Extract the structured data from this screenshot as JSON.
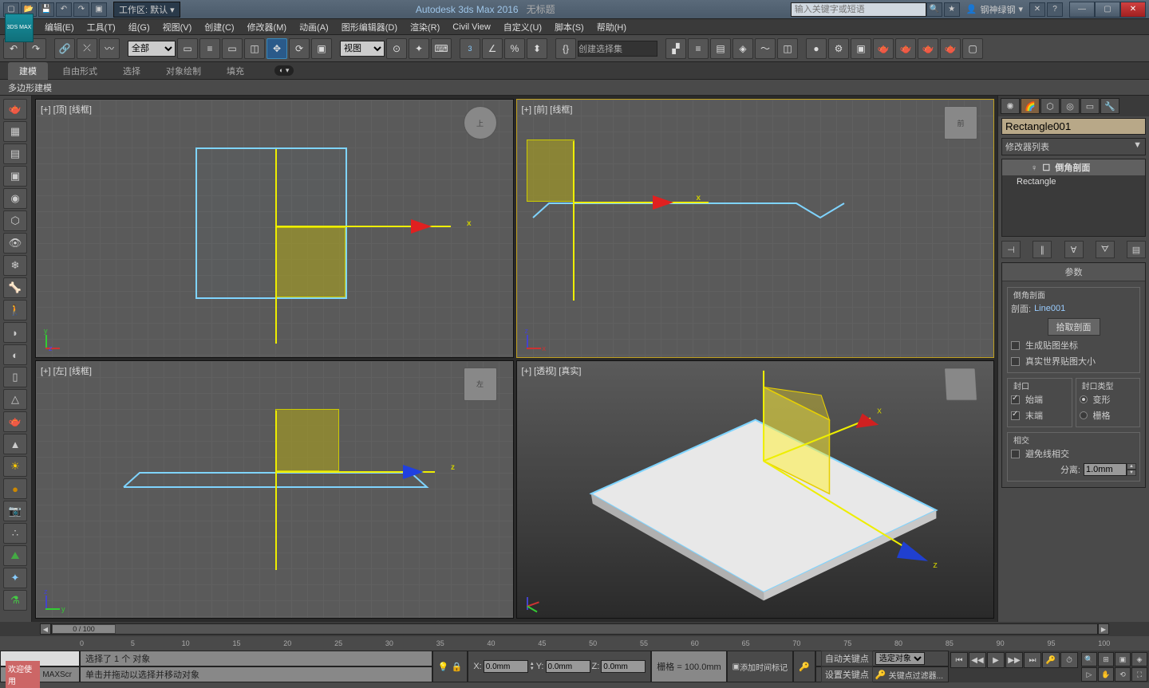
{
  "titlebar": {
    "workspace_label": "工作区: 默认",
    "app_title": "Autodesk 3ds Max 2016",
    "doc_title": "无标题",
    "search_placeholder": "输入关键字或短语",
    "user": "钢神绿钢",
    "logo": "3DS\nMAX"
  },
  "menus": [
    "编辑(E)",
    "工具(T)",
    "组(G)",
    "视图(V)",
    "创建(C)",
    "修改器(M)",
    "动画(A)",
    "图形编辑器(D)",
    "渲染(R)",
    "Civil View",
    "自定义(U)",
    "脚本(S)",
    "帮助(H)"
  ],
  "toolbar": {
    "filter": "全部",
    "refsys": "视图",
    "snap_num": "3",
    "selset": "创建选择集"
  },
  "ribbon": {
    "tabs": [
      "建模",
      "自由形式",
      "选择",
      "对象绘制",
      "填充"
    ],
    "sub": "多边形建模"
  },
  "viewports": {
    "top": "[+] [顶] [线框]",
    "front": "[+] [前] [线框]",
    "left": "[+] [左] [线框]",
    "persp": "[+] [透视] [真实]",
    "cube_top": "上",
    "cube_front": "前",
    "cube_left": "左"
  },
  "panel": {
    "object_name": "Rectangle001",
    "modlist_label": "修改器列表",
    "stack": {
      "mod": "倒角剖面",
      "base": "Rectangle"
    },
    "rollout": "参数",
    "group_bevel": "倒角剖面",
    "profile_label": "剖面:",
    "profile_value": "Line001",
    "pick_btn": "拾取剖面",
    "gen_uv": "生成贴图坐标",
    "real_uv": "真实世界贴图大小",
    "cap_grp": "封口",
    "cap_start": "始端",
    "cap_end": "末端",
    "cap_type_grp": "封口类型",
    "cap_morph": "变形",
    "cap_grid": "栅格",
    "intersect_grp": "相交",
    "avoid": "避免线相交",
    "sep_label": "分离:",
    "sep_value": "1.0mm"
  },
  "time": {
    "slider": "0 / 100",
    "ticks": [
      "0",
      "5",
      "10",
      "15",
      "20",
      "25",
      "30",
      "35",
      "40",
      "45",
      "50",
      "55",
      "60",
      "65",
      "70",
      "75",
      "80",
      "85",
      "90",
      "95",
      "100"
    ]
  },
  "status": {
    "sel": "选择了 1 个 对象",
    "hint": "单击并拖动以选择并移动对象",
    "welcome": "欢迎使用",
    "maxscr": "MAXScr",
    "x": "X:",
    "y": "Y:",
    "z": "Z:",
    "xv": "0.0mm",
    "yv": "0.0mm",
    "zv": "0.0mm",
    "grid": "栅格 = 100.0mm",
    "autokey": "自动关键点",
    "setkey": "设置关键点",
    "keytgt": "选定对象",
    "keyfilter": "关键点过滤器...",
    "addtime": "添加时间标记"
  }
}
